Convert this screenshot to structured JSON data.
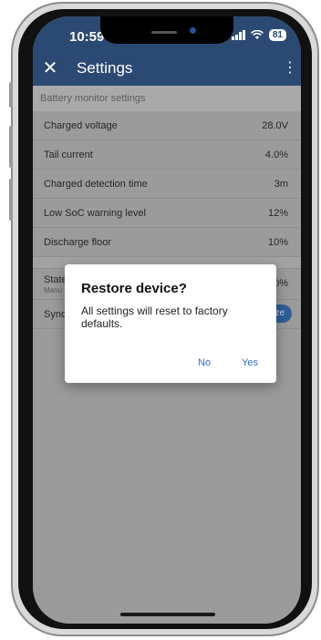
{
  "status_bar": {
    "time": "10:59",
    "battery": "81"
  },
  "app_bar": {
    "close_icon": "close-icon",
    "title": "Settings",
    "menu_icon": "more-vert-icon",
    "background_color": "#2b4a73"
  },
  "section": {
    "header": "Battery monitor settings"
  },
  "settings": [
    {
      "label": "Charged voltage",
      "value": "28.0V"
    },
    {
      "label": "Tail current",
      "value": "4.0%"
    },
    {
      "label": "Charged detection time",
      "value": "3m"
    },
    {
      "label": "Low SoC warning level",
      "value": "12%"
    },
    {
      "label": "Discharge floor",
      "value": "10%"
    }
  ],
  "state_row": {
    "label": "State",
    "sublabel": "Manu",
    "value": "00.0%"
  },
  "sync_row": {
    "label": "Synch",
    "button_label": "ze"
  },
  "dialog": {
    "title": "Restore device?",
    "message": "All settings will reset to factory defaults.",
    "no_label": "No",
    "yes_label": "Yes",
    "accent_color": "#2f6ecb"
  }
}
